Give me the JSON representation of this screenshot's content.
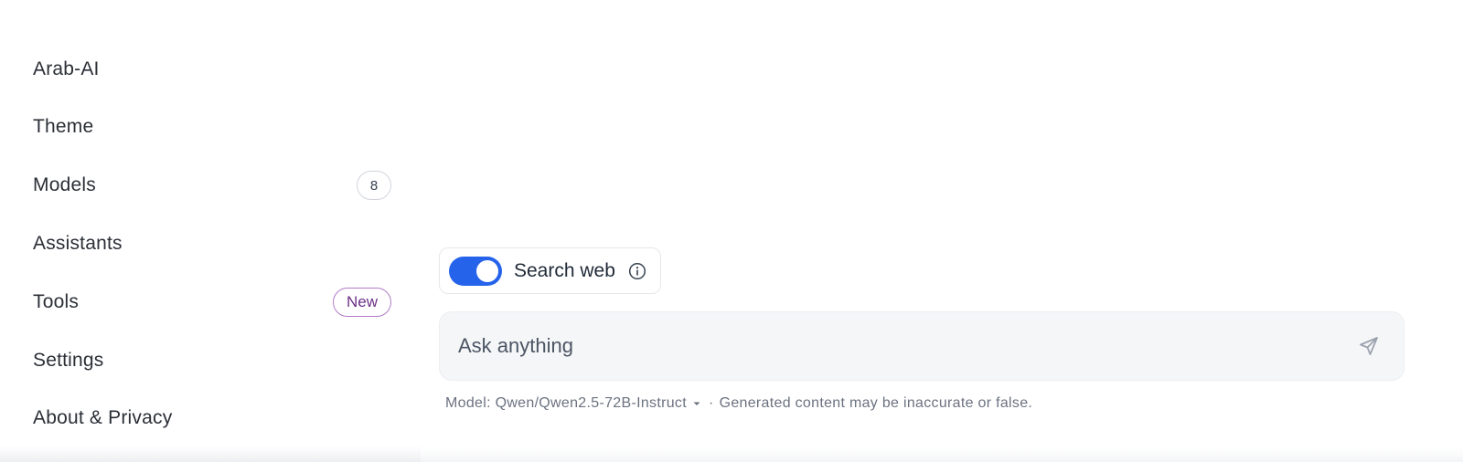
{
  "sidebar": {
    "items": [
      {
        "label": "Arab-AI"
      },
      {
        "label": "Theme"
      },
      {
        "label": "Models",
        "badge": "8"
      },
      {
        "label": "Assistants"
      },
      {
        "label": "Tools",
        "badge": "New"
      },
      {
        "label": "Settings"
      },
      {
        "label": "About & Privacy"
      }
    ]
  },
  "composer": {
    "search_web": {
      "label": "Search web",
      "enabled": true,
      "icon": "info-icon"
    },
    "input": {
      "value": "",
      "placeholder": "Ask anything"
    },
    "send_icon": "send-icon"
  },
  "footer": {
    "model_label": "Model: Qwen/Qwen2.5-72B-Instruct",
    "separator": "·",
    "disclaimer": "Generated content may be inaccurate or false."
  },
  "colors": {
    "toggle_on": "#2563eb",
    "new_badge_border": "#b07cc6",
    "new_badge_text": "#6b2f86"
  }
}
